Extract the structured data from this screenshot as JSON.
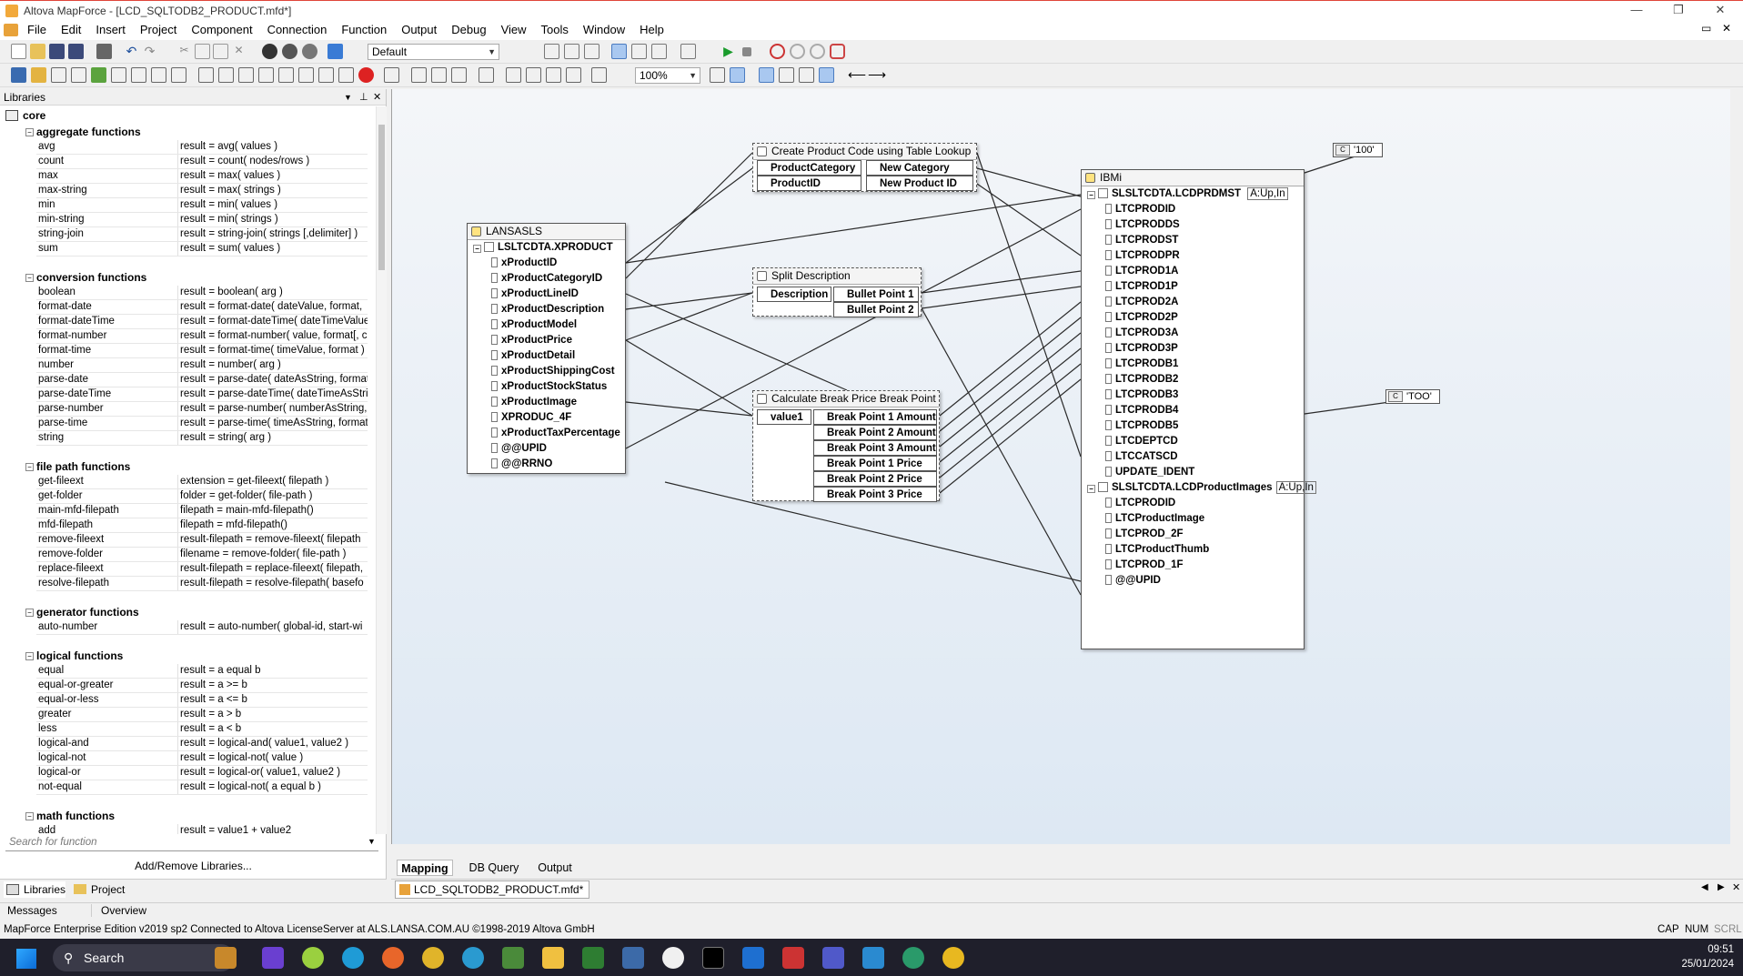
{
  "window": {
    "title": "Altova MapForce - [LCD_SQLTODB2_PRODUCT.mfd*]"
  },
  "menu": [
    "File",
    "Edit",
    "Insert",
    "Project",
    "Component",
    "Connection",
    "Function",
    "Output",
    "Debug",
    "View",
    "Tools",
    "Window",
    "Help"
  ],
  "toolbar": {
    "mode_select": "Default",
    "zoom_select": "100%"
  },
  "libraries": {
    "header": "Libraries",
    "root": "core",
    "categories": [
      {
        "name": "aggregate functions",
        "items": [
          [
            "avg",
            "result = avg( values )"
          ],
          [
            "count",
            "result = count( nodes/rows )"
          ],
          [
            "max",
            "result = max( values )"
          ],
          [
            "max-string",
            "result = max( strings )"
          ],
          [
            "min",
            "result = min( values )"
          ],
          [
            "min-string",
            "result = min( strings )"
          ],
          [
            "string-join",
            "result = string-join( strings [,delimiter] )"
          ],
          [
            "sum",
            "result = sum( values )"
          ]
        ]
      },
      {
        "name": "conversion functions",
        "items": [
          [
            "boolean",
            "result = boolean( arg )"
          ],
          [
            "format-date",
            "result = format-date( dateValue, format,"
          ],
          [
            "format-dateTime",
            "result = format-dateTime( dateTimeValue"
          ],
          [
            "format-number",
            "result = format-number( value, format[, c"
          ],
          [
            "format-time",
            "result = format-time( timeValue, format )"
          ],
          [
            "number",
            "result = number( arg )"
          ],
          [
            "parse-date",
            "result = parse-date( dateAsString, format"
          ],
          [
            "parse-dateTime",
            "result = parse-dateTime( dateTimeAsStrin"
          ],
          [
            "parse-number",
            "result = parse-number( numberAsString,"
          ],
          [
            "parse-time",
            "result = parse-time( timeAsString, format"
          ],
          [
            "string",
            "result = string( arg )"
          ]
        ]
      },
      {
        "name": "file path functions",
        "items": [
          [
            "get-fileext",
            "extension = get-fileext( filepath )"
          ],
          [
            "get-folder",
            "folder = get-folder( file-path )"
          ],
          [
            "main-mfd-filepath",
            "filepath = main-mfd-filepath()"
          ],
          [
            "mfd-filepath",
            "filepath = mfd-filepath()"
          ],
          [
            "remove-fileext",
            "result-filepath = remove-fileext( filepath"
          ],
          [
            "remove-folder",
            "filename = remove-folder( file-path )"
          ],
          [
            "replace-fileext",
            "result-filepath = replace-fileext( filepath,"
          ],
          [
            "resolve-filepath",
            "result-filepath = resolve-filepath( basefo"
          ]
        ]
      },
      {
        "name": "generator functions",
        "items": [
          [
            "auto-number",
            "result = auto-number( global-id, start-wi"
          ]
        ]
      },
      {
        "name": "logical functions",
        "items": [
          [
            "equal",
            "result = a equal b"
          ],
          [
            "equal-or-greater",
            "result = a >= b"
          ],
          [
            "equal-or-less",
            "result = a <= b"
          ],
          [
            "greater",
            "result = a > b"
          ],
          [
            "less",
            "result = a < b"
          ],
          [
            "logical-and",
            "result = logical-and( value1, value2 )"
          ],
          [
            "logical-not",
            "result = logical-not( value )"
          ],
          [
            "logical-or",
            "result = logical-or( value1, value2 )"
          ],
          [
            "not-equal",
            "result = logical-not( a equal b )"
          ]
        ]
      },
      {
        "name": "math functions",
        "items": [
          [
            "add",
            "result = value1 + value2"
          ]
        ]
      }
    ],
    "search_placeholder": "Search for function",
    "add_remove": "Add/Remove Libraries..."
  },
  "panel_tabs": [
    "Libraries",
    "Project"
  ],
  "view_tabs": [
    "Mapping",
    "DB Query",
    "Output"
  ],
  "document_tab": "LCD_SQLTODB2_PRODUCT.mfd*",
  "message_tabs": [
    "Messages",
    "Overview"
  ],
  "status": {
    "left": "MapForce Enterprise Edition v2019 sp2   Connected to Altova LicenseServer at ALS.LANSA.COM.AU   ©1998-2019 Altova GmbH",
    "caps": "CAP",
    "num": "NUM",
    "scrl": "SCRL"
  },
  "taskbar": {
    "search": "Search",
    "time": "09:51",
    "date": "25/01/2024"
  },
  "mapping": {
    "source": {
      "title": "LANSASLS",
      "table": "LSLTCDTA.XPRODUCT",
      "fields": [
        "xProductID",
        "xProductCategoryID",
        "xProductLineID",
        "xProductDescription",
        "xProductModel",
        "xProductPrice",
        "xProductDetail",
        "xProductShippingCost",
        "xProductStockStatus",
        "xProductImage",
        "XPRODUC_4F",
        "xProductTaxPercentage",
        "@@UPID",
        "@@RRNO"
      ]
    },
    "fn_lookup": {
      "title": "Create Product Code using Table Lookup",
      "inputs": [
        "ProductCategory",
        "ProductID"
      ],
      "outputs": [
        "New Category Code",
        "New Product ID"
      ]
    },
    "fn_split": {
      "title": "Split Description",
      "inputs": [
        "Description"
      ],
      "outputs": [
        "Bullet Point 1",
        "Bullet Point 2"
      ]
    },
    "fn_break": {
      "title": "Calculate Break Price Break Point",
      "inputs": [
        "value1"
      ],
      "outputs": [
        "Break Point 1 Amount",
        "Break Point 2 Amount",
        "Break Point 3 Amount",
        "Break Point 1 Price",
        "Break Point 2 Price",
        "Break Point 3 Price"
      ]
    },
    "target": {
      "title": "IBMi",
      "table1": "SLSLTCDTA.LCDPRDMST",
      "table1_badge": "A:Up,In",
      "fields1": [
        "LTCPRODID",
        "LTCPRODDS",
        "LTCPRODST",
        "LTCPRODPR",
        "LTCPROD1A",
        "LTCPROD1P",
        "LTCPROD2A",
        "LTCPROD2P",
        "LTCPROD3A",
        "LTCPROD3P",
        "LTCPRODB1",
        "LTCPRODB2",
        "LTCPRODB3",
        "LTCPRODB4",
        "LTCPRODB5",
        "LTCDEPTCD",
        "LTCCATSCD",
        "UPDATE_IDENT"
      ],
      "table2": "SLSLTCDTA.LCDProductImages",
      "table2_badge": "A:Up,In",
      "fields2": [
        "LTCPRODID",
        "LTCProductImage",
        "LTCPROD_2F",
        "LTCProductThumb",
        "LTCPROD_1F",
        "@@UPID"
      ]
    },
    "const1": "'100'",
    "const2": "'TOO'"
  }
}
